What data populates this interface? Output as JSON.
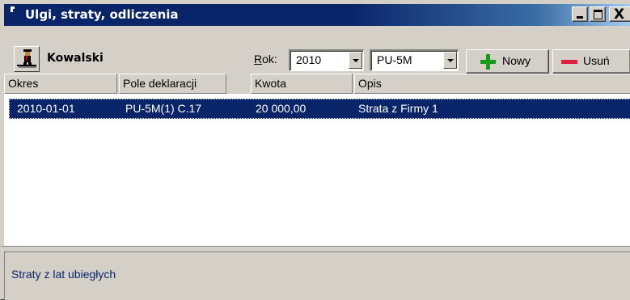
{
  "window": {
    "title": "Ulgi, straty, odliczenia",
    "controls": {
      "close_label": "X"
    }
  },
  "toolbar": {
    "user_name": "Kowalski",
    "rok_label_accel": "R",
    "rok_label_rest": "ok:",
    "rok_value": "2010",
    "form_value": "PU-5M",
    "new_label": "Nowy",
    "delete_label": "Usuń"
  },
  "table": {
    "columns": [
      "Okres",
      "Pole deklaracji",
      "Kwota",
      "Opis"
    ],
    "rows": [
      {
        "okres": "2010-01-01",
        "pole": "PU-5M(1) C.17",
        "kwota": "20 000,00",
        "opis": "Strata z Firmy 1",
        "selected": true
      }
    ]
  },
  "status": {
    "text": "Straty z lat ubiegłych"
  },
  "colors": {
    "titlebar": "#0a246a",
    "selection": "#0a246a",
    "add_icon": "#1a9a1a",
    "remove_icon": "#e0203a",
    "status_text": "#0a246a"
  },
  "icons": {
    "title": "app-icon",
    "user": "person-icon",
    "add": "plus-icon",
    "remove": "minus-icon"
  }
}
